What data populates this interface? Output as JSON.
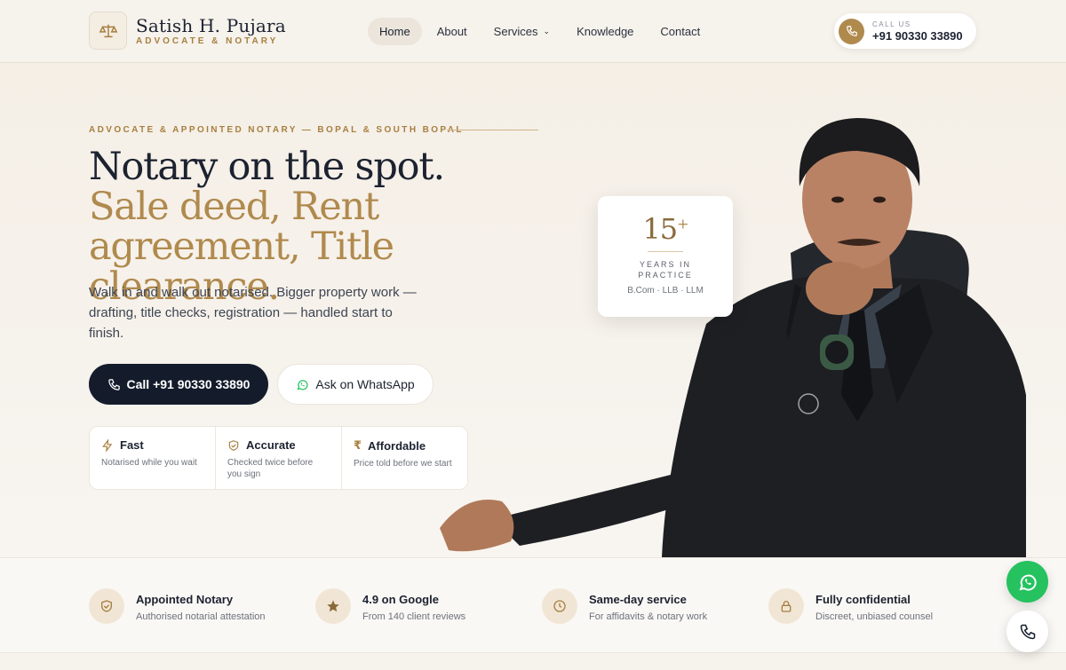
{
  "header": {
    "brand_name": "Satish H. Pujara",
    "brand_tagline": "ADVOCATE & NOTARY",
    "nav": [
      {
        "label": "Home",
        "active": true
      },
      {
        "label": "About"
      },
      {
        "label": "Services",
        "has_dropdown": true
      },
      {
        "label": "Knowledge"
      },
      {
        "label": "Contact"
      }
    ],
    "call_label": "CALL US",
    "call_number": "+91 90330 33890"
  },
  "hero": {
    "eyebrow": "ADVOCATE & APPOINTED NOTARY — BOPAL & SOUTH BOPAL",
    "headline_dark": "Notary on the spot.",
    "headline_gold": "Sale deed, Rent agreement, Title clearance.",
    "lede": "Walk in and walk out notarised. Bigger property work — drafting, title checks, registration — handled start to finish.",
    "primary_button": "Call +91 90330 33890",
    "secondary_button": "Ask on WhatsApp",
    "features": [
      {
        "title": "Fast",
        "desc": "Notarised while you wait",
        "icon": "lightning-icon"
      },
      {
        "title": "Accurate",
        "desc": "Checked twice before you sign",
        "icon": "shield-check-icon"
      },
      {
        "title": "Affordable",
        "desc": "Price told before we start",
        "icon": "rupee-icon"
      }
    ]
  },
  "years_card": {
    "number": "15",
    "plus": "+",
    "label_line1": "YEARS IN",
    "label_line2": "PRACTICE",
    "degrees": "B.Com · LLB · LLM"
  },
  "trust": [
    {
      "title": "Appointed Notary",
      "desc": "Authorised notarial attestation",
      "icon": "shield-icon"
    },
    {
      "title": "4.9 on Google",
      "desc": "From 140 client reviews",
      "icon": "star-icon"
    },
    {
      "title": "Same-day service",
      "desc": "For affidavits & notary work",
      "icon": "clock-icon"
    },
    {
      "title": "Fully confidential",
      "desc": "Discreet, unbiased counsel",
      "icon": "lock-icon"
    }
  ],
  "colors": {
    "accent_gold": "#b08a4d",
    "navy": "#141c2c",
    "whatsapp_green": "#25c25f"
  }
}
